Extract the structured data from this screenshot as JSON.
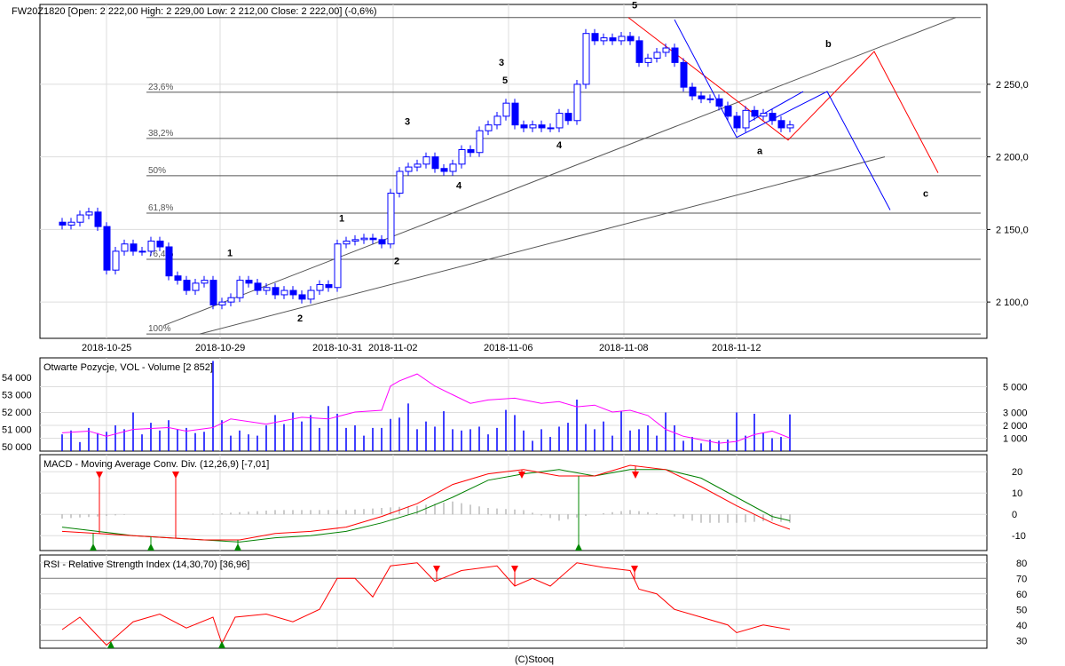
{
  "header": {
    "title": "FW20Z1820 [Open: 2 222,00  High: 2 229,00  Low: 2 212,00  Close: 2 222,00] (-0,6%)"
  },
  "footer": "(C)Stooq",
  "colors": {
    "up": "#ffffff",
    "down": "#0000ff",
    "oi": "#ff00ff",
    "macd": "#ff0000",
    "signal": "#008000",
    "rsi": "#ff0000"
  },
  "chart_data": [
    {
      "type": "candlestick",
      "name": "price",
      "ylim": [
        2075,
        2305
      ],
      "y_ticks": [
        {
          "v": 2250,
          "label": "2 250,0"
        },
        {
          "v": 2200,
          "label": "2 200,0"
        },
        {
          "v": 2150,
          "label": "2 150,0"
        },
        {
          "v": 2100,
          "label": "2 100,0"
        }
      ],
      "x_ticks": [
        {
          "i": 5,
          "label": "2018-10-25"
        },
        {
          "i": 17.8,
          "label": "2018-10-29"
        },
        {
          "i": 31,
          "label": "2018-10-31"
        },
        {
          "i": 37.3,
          "label": "2018-11-02"
        },
        {
          "i": 50.3,
          "label": "2018-11-06"
        },
        {
          "i": 63.3,
          "label": "2018-11-08"
        },
        {
          "i": 76,
          "label": "2018-11-12"
        }
      ],
      "close": [
        2153,
        2155,
        2160,
        2162,
        2152,
        2122,
        2135,
        2140,
        2135,
        2135,
        2142,
        2138,
        2118,
        2115,
        2108,
        2113,
        2115,
        2098,
        2100,
        2103,
        2115,
        2113,
        2108,
        2110,
        2105,
        2108,
        2105,
        2102,
        2108,
        2112,
        2110,
        2140,
        2142,
        2143,
        2144,
        2143,
        2140,
        2175,
        2190,
        2193,
        2195,
        2200,
        2192,
        2190,
        2195,
        2205,
        2203,
        2218,
        2222,
        2228,
        2237,
        2222,
        2220,
        2222,
        2220,
        2220,
        2230,
        2225,
        2250,
        2285,
        2280,
        2282,
        2280,
        2283,
        2280,
        2265,
        2268,
        2272,
        2275,
        2265,
        2248,
        2242,
        2240,
        2240,
        2235,
        2228,
        2220,
        2232,
        2228,
        2230,
        2225,
        2220,
        2222
      ],
      "fib": {
        "high": 2296,
        "low": 2078,
        "levels": [
          {
            "p": 0.236,
            "label": "23,6%"
          },
          {
            "p": 0.382,
            "label": "38,2%"
          },
          {
            "p": 0.5,
            "label": "50%"
          },
          {
            "p": 0.618,
            "label": "61,8%"
          },
          {
            "p": 0.764,
            "label": "76,4%"
          },
          {
            "p": 1.0,
            "label": "100%"
          }
        ]
      },
      "lines": [
        {
          "c": "#555",
          "pts": [
            [
              11.5,
              2084
            ],
            [
              100.7,
              2296
            ]
          ]
        },
        {
          "c": "#555",
          "pts": [
            [
              15.5,
              2078
            ],
            [
              92.7,
              2200
            ]
          ]
        },
        {
          "c": "#ff0000",
          "pts": [
            [
              63.8,
              2296
            ],
            [
              81.8,
              2211.6
            ],
            [
              91.5,
              2272.6
            ],
            [
              98.7,
              2189
            ]
          ]
        },
        {
          "c": "#0000ff",
          "pts": [
            [
              69,
              2294.5
            ],
            [
              76,
              2213.4
            ],
            [
              86.2,
              2245
            ],
            [
              93.3,
              2163.4
            ]
          ]
        },
        {
          "c": "#0000ff",
          "pts": [
            [
              76.8,
              2222
            ],
            [
              83.5,
              2245
            ]
          ]
        }
      ],
      "wave_labels": [
        {
          "t": "1",
          "i": 18.6,
          "v": 2131.7,
          "c": "#cc0000"
        },
        {
          "t": "2",
          "i": 26.5,
          "v": 2086.6,
          "c": "#cc0000"
        },
        {
          "t": "3",
          "i": 49.2,
          "v": 2262.8,
          "c": "#cc0000"
        },
        {
          "t": "4",
          "i": 55.7,
          "v": 2206,
          "c": "#cc0000"
        },
        {
          "t": "5",
          "i": 64.2,
          "v": 2302.4,
          "c": "#cc0000"
        },
        {
          "t": "1",
          "i": 31.2,
          "v": 2155.5,
          "c": "#555"
        },
        {
          "t": "2",
          "i": 37.4,
          "v": 2126.2,
          "c": "#555"
        },
        {
          "t": "3",
          "i": 38.6,
          "v": 2222,
          "c": "#555"
        },
        {
          "t": "4",
          "i": 44.4,
          "v": 2178,
          "c": "#555"
        },
        {
          "t": "5",
          "i": 49.6,
          "v": 2250.6,
          "c": "#555"
        },
        {
          "t": "a",
          "i": 78.3,
          "v": 2201.8,
          "c": "#555"
        },
        {
          "t": "b",
          "i": 86,
          "v": 2275.6,
          "c": "#555"
        },
        {
          "t": "c",
          "i": 97,
          "v": 2172.6,
          "c": "#555"
        }
      ]
    },
    {
      "type": "bar",
      "name": "volume",
      "title": "Otwarte Pozycje, VOL - Volume [2 852]",
      "ylim": [
        0,
        5000
      ],
      "y_ticks": [
        {
          "v": 5000,
          "label": "5 000"
        },
        {
          "v": 3000,
          "label": "3 000"
        },
        {
          "v": 2000,
          "label": "2 000"
        },
        {
          "v": 1000,
          "label": "1 000"
        }
      ],
      "oi_ticks": [
        {
          "v": 54000,
          "label": "54 000"
        },
        {
          "v": 53000,
          "label": "53 000"
        },
        {
          "v": 52000,
          "label": "52 000"
        },
        {
          "v": 51000,
          "label": "51 000"
        },
        {
          "v": 50000,
          "label": "50 000"
        }
      ],
      "values": [
        1300,
        1600,
        700,
        1800,
        1400,
        1500,
        2000,
        1700,
        3000,
        1300,
        2200,
        1600,
        2400,
        1700,
        1800,
        1400,
        1500,
        7000,
        2400,
        1200,
        1600,
        1300,
        1200,
        2000,
        2800,
        2100,
        3000,
        2300,
        2800,
        1800,
        3500,
        2900,
        1800,
        2000,
        1200,
        1800,
        1800,
        2500,
        2600,
        3700,
        1700,
        2300,
        1900,
        3100,
        1700,
        1600,
        1700,
        1900,
        1300,
        1800,
        3200,
        2800,
        1600,
        800,
        1700,
        1100,
        1900,
        2200,
        4000,
        2100,
        1700,
        2300,
        1200,
        3100,
        1600,
        1700,
        2000,
        1200,
        3000,
        2000,
        800,
        1100,
        600,
        900,
        800,
        900,
        3000,
        1200,
        2900,
        1400,
        1000,
        1100,
        2852
      ],
      "oi": [
        [
          0,
          50800
        ],
        [
          3,
          50900
        ],
        [
          5,
          50600
        ],
        [
          8,
          51000
        ],
        [
          12,
          51100
        ],
        [
          14,
          50900
        ],
        [
          17,
          51100
        ],
        [
          19,
          51600
        ],
        [
          23,
          51300
        ],
        [
          27,
          51700
        ],
        [
          30,
          51600
        ],
        [
          33,
          52000
        ],
        [
          36,
          52100
        ],
        [
          37,
          53500
        ],
        [
          38,
          53800
        ],
        [
          40,
          54200
        ],
        [
          42,
          53500
        ],
        [
          44,
          53000
        ],
        [
          46,
          52500
        ],
        [
          48,
          52700
        ],
        [
          51,
          52800
        ],
        [
          54,
          52500
        ],
        [
          56,
          52600
        ],
        [
          58,
          52300
        ],
        [
          60,
          52400
        ],
        [
          62,
          52000
        ],
        [
          64,
          52100
        ],
        [
          66,
          51800
        ],
        [
          68,
          51000
        ],
        [
          70,
          50600
        ],
        [
          72,
          50400
        ],
        [
          74,
          50200
        ],
        [
          76,
          50300
        ],
        [
          78,
          50700
        ],
        [
          80,
          50900
        ],
        [
          82,
          50500
        ]
      ]
    },
    {
      "type": "line",
      "name": "macd",
      "title": "MACD - Moving Average Conv. Div. (12,26,9) [-7,01]",
      "ylim": [
        -17,
        28
      ],
      "y_ticks": [
        {
          "v": 20,
          "label": "20"
        },
        {
          "v": 10,
          "label": "10"
        },
        {
          "v": 0,
          "label": "0"
        },
        {
          "v": -10,
          "label": "-10"
        }
      ],
      "macd": [
        [
          0,
          -8
        ],
        [
          4,
          -9
        ],
        [
          8,
          -10
        ],
        [
          12,
          -11
        ],
        [
          16,
          -12
        ],
        [
          20,
          -12
        ],
        [
          24,
          -9
        ],
        [
          28,
          -8
        ],
        [
          32,
          -6
        ],
        [
          36,
          -1
        ],
        [
          40,
          5
        ],
        [
          44,
          14
        ],
        [
          48,
          19
        ],
        [
          52,
          21
        ],
        [
          56,
          18
        ],
        [
          60,
          18
        ],
        [
          64,
          23
        ],
        [
          68,
          21
        ],
        [
          72,
          13
        ],
        [
          76,
          4
        ],
        [
          80,
          -4
        ],
        [
          82,
          -7
        ]
      ],
      "signal": [
        [
          0,
          -6
        ],
        [
          4,
          -8
        ],
        [
          8,
          -10
        ],
        [
          12,
          -11
        ],
        [
          16,
          -12
        ],
        [
          20,
          -13
        ],
        [
          24,
          -11
        ],
        [
          28,
          -10
        ],
        [
          32,
          -8
        ],
        [
          36,
          -4
        ],
        [
          40,
          1
        ],
        [
          44,
          8
        ],
        [
          48,
          16
        ],
        [
          52,
          19
        ],
        [
          56,
          21
        ],
        [
          60,
          18
        ],
        [
          64,
          21
        ],
        [
          68,
          21
        ],
        [
          72,
          17
        ],
        [
          76,
          8
        ],
        [
          80,
          -1
        ],
        [
          82,
          -3
        ]
      ],
      "sell": [
        4.2,
        12.8,
        51.8,
        64.6
      ],
      "buy": [
        3.5,
        10,
        19.8,
        58.2
      ]
    },
    {
      "type": "line",
      "name": "rsi",
      "title": "RSI - Relative Strength Index (14,30,70) [36,96]",
      "ylim": [
        25,
        85
      ],
      "y_ticks": [
        {
          "v": 80,
          "label": "80"
        },
        {
          "v": 70,
          "label": "70"
        },
        {
          "v": 60,
          "label": "60"
        },
        {
          "v": 50,
          "label": "50"
        },
        {
          "v": 40,
          "label": "40"
        },
        {
          "v": 30,
          "label": "30"
        }
      ],
      "values": [
        [
          0,
          37
        ],
        [
          2,
          45
        ],
        [
          4,
          33
        ],
        [
          5,
          27
        ],
        [
          8,
          42
        ],
        [
          11,
          47
        ],
        [
          14,
          38
        ],
        [
          17,
          45
        ],
        [
          18,
          28
        ],
        [
          19.5,
          45
        ],
        [
          23,
          47
        ],
        [
          26,
          42
        ],
        [
          29,
          50
        ],
        [
          31,
          70
        ],
        [
          33,
          70
        ],
        [
          35,
          58
        ],
        [
          37,
          78
        ],
        [
          40,
          80
        ],
        [
          42,
          68
        ],
        [
          45,
          75
        ],
        [
          49,
          78
        ],
        [
          51,
          65
        ],
        [
          53,
          70
        ],
        [
          55,
          65
        ],
        [
          58,
          80
        ],
        [
          61,
          77
        ],
        [
          64,
          75
        ],
        [
          65,
          63
        ],
        [
          67,
          60
        ],
        [
          69,
          50
        ],
        [
          72,
          45
        ],
        [
          75,
          40
        ],
        [
          76,
          35
        ],
        [
          79,
          40
        ],
        [
          82,
          37
        ]
      ],
      "sell": [
        42.2,
        51,
        64.5
      ],
      "buy": [
        5.5,
        18
      ]
    }
  ]
}
